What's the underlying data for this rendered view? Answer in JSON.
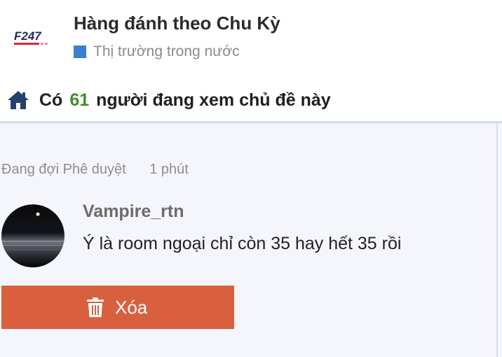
{
  "header": {
    "logo_text": "F247",
    "title": "Hàng đánh theo Chu Kỳ",
    "category": "Thị trường trong nước",
    "category_color": "#3b7fd0"
  },
  "viewers": {
    "prefix": "Có",
    "count": "61",
    "suffix": "người đang xem chủ đề này",
    "count_color": "#3f8c2a"
  },
  "post": {
    "status": "Đang đợi Phê duyệt",
    "time": "1 phút",
    "author": "Vampire_rtn",
    "message": "Ý là room ngoại chỉ còn 35 hay hết 35 rồi",
    "delete_label": "Xóa",
    "delete_color": "#d9603f"
  },
  "icons": {
    "home": "home-icon",
    "trash": "trash-icon"
  }
}
